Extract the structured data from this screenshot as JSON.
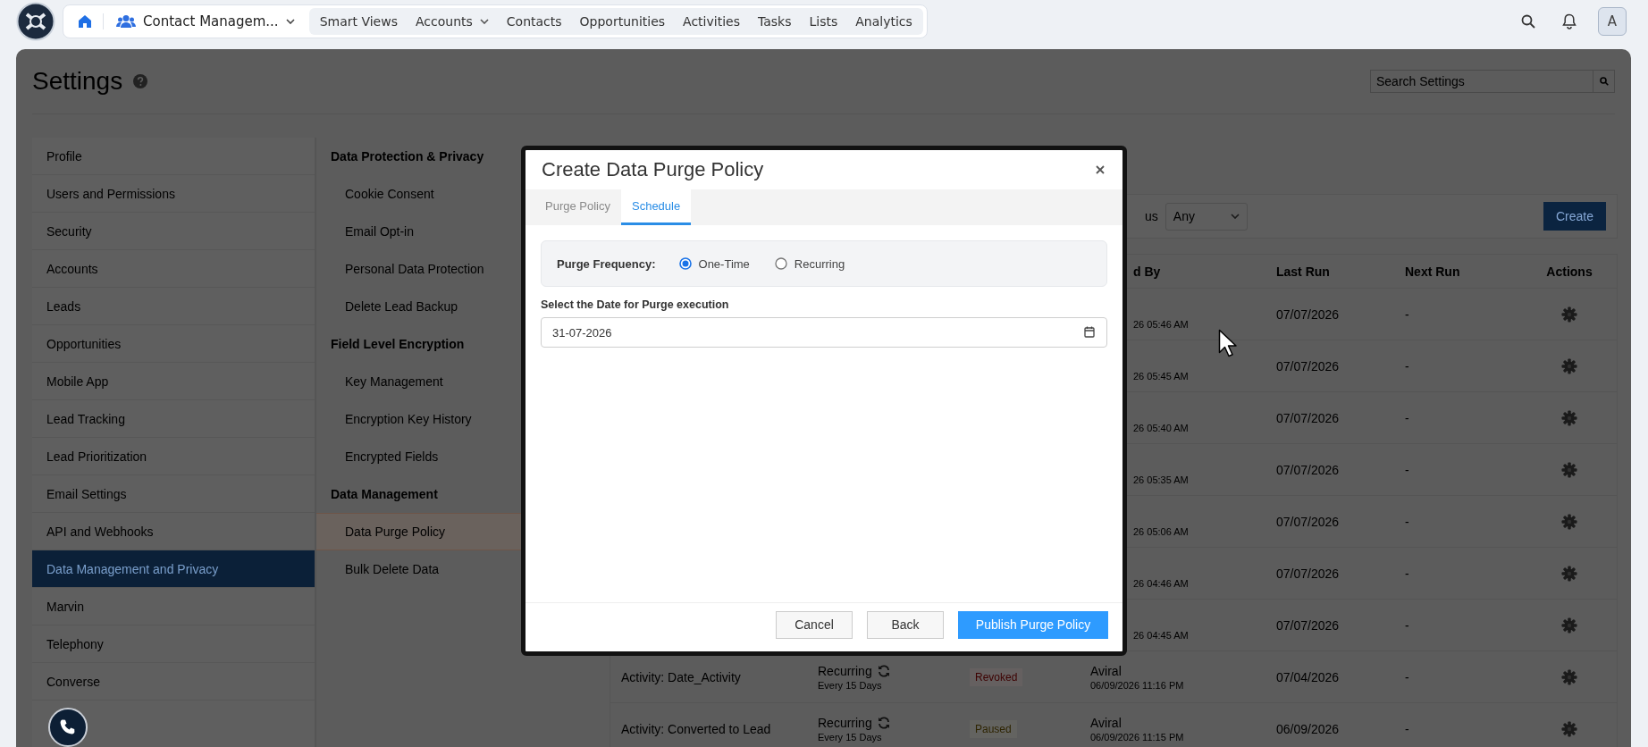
{
  "nav": {
    "app_name": "Contact Managem...",
    "menu": [
      {
        "label": "Smart Views",
        "dropdown": false
      },
      {
        "label": "Accounts",
        "dropdown": true
      },
      {
        "label": "Contacts",
        "dropdown": false
      },
      {
        "label": "Opportunities",
        "dropdown": false
      },
      {
        "label": "Activities",
        "dropdown": false
      },
      {
        "label": "Tasks",
        "dropdown": false
      },
      {
        "label": "Lists",
        "dropdown": false
      },
      {
        "label": "Analytics",
        "dropdown": false
      }
    ],
    "avatar": "A"
  },
  "settings": {
    "title": "Settings",
    "search": {
      "placeholder": "Search Settings"
    },
    "categories": [
      {
        "label": "Profile",
        "selected": false
      },
      {
        "label": "Users and Permissions",
        "selected": false
      },
      {
        "label": "Security",
        "selected": false
      },
      {
        "label": "Accounts",
        "selected": false
      },
      {
        "label": "Leads",
        "selected": false
      },
      {
        "label": "Opportunities",
        "selected": false
      },
      {
        "label": "Mobile App",
        "selected": false
      },
      {
        "label": "Lead Tracking",
        "selected": false
      },
      {
        "label": "Lead Prioritization",
        "selected": false
      },
      {
        "label": "Email Settings",
        "selected": false
      },
      {
        "label": "API and Webhooks",
        "selected": false
      },
      {
        "label": "Data Management and Privacy",
        "selected": true
      },
      {
        "label": "Marvin",
        "selected": false
      },
      {
        "label": "Telephony",
        "selected": false
      },
      {
        "label": "Converse",
        "selected": false
      }
    ],
    "subnav": [
      {
        "heading": "Data Protection & Privacy",
        "items": [
          {
            "label": "Cookie Consent",
            "selected": false
          },
          {
            "label": "Email Opt-in",
            "selected": false
          },
          {
            "label": "Personal Data Protection",
            "selected": false
          },
          {
            "label": "Delete Lead Backup",
            "selected": false
          }
        ]
      },
      {
        "heading": "Field Level Encryption",
        "items": [
          {
            "label": "Key Management",
            "selected": false
          },
          {
            "label": "Encryption Key History",
            "selected": false
          },
          {
            "label": "Encrypted Fields",
            "selected": false
          }
        ]
      },
      {
        "heading": "Data Management",
        "items": [
          {
            "label": "Data Purge Policy",
            "selected": true
          },
          {
            "label": "Bulk Delete Data",
            "selected": false
          }
        ]
      }
    ]
  },
  "policies": {
    "filter": {
      "label": "us",
      "value": "Any"
    },
    "create_button": "Create",
    "columns": [
      "d By",
      "Last Run",
      "Next Run",
      "Actions"
    ],
    "rows": [
      {
        "kind": "partial",
        "created_at": "26 05:46 AM",
        "last_run": "07/07/2026",
        "next_run": "-"
      },
      {
        "kind": "partial",
        "created_at": "26 05:45 AM",
        "last_run": "07/07/2026",
        "next_run": "-"
      },
      {
        "kind": "partial",
        "created_at": "26 05:40 AM",
        "last_run": "07/07/2026",
        "next_run": "-"
      },
      {
        "kind": "partial",
        "created_at": "26 05:35 AM",
        "last_run": "07/07/2026",
        "next_run": "-"
      },
      {
        "kind": "partial",
        "created_at": "26 05:06 AM",
        "last_run": "07/07/2026",
        "next_run": "-"
      },
      {
        "kind": "partial",
        "created_at": "26 04:46 AM",
        "last_run": "07/07/2026",
        "next_run": "-"
      },
      {
        "kind": "partial",
        "created_at": "26 04:45 AM",
        "last_run": "07/07/2026",
        "next_run": "-"
      },
      {
        "kind": "full",
        "name": "Activity: Date_Activity",
        "schedule": "Recurring",
        "interval": "Every 15 Days",
        "status": {
          "label": "Revoked",
          "color": "#3d0000"
        },
        "created_by": "Aviral",
        "created_at": "06/09/2026 11:16 PM",
        "last_run": "07/04/2026",
        "next_run": "-"
      },
      {
        "kind": "full",
        "name": "Activity: Converted to Lead",
        "schedule": "Recurring",
        "interval": "Every 15 Days",
        "status": {
          "label": "Paused",
          "color": "#2e2400"
        },
        "created_by": "Aviral",
        "created_at": "06/09/2026 11:15 PM",
        "last_run": "06/09/2026",
        "next_run": "-"
      }
    ]
  },
  "dialog": {
    "title": "Create Data Purge Policy",
    "tabs": [
      {
        "label": "Purge Policy",
        "selected": false
      },
      {
        "label": "Schedule",
        "selected": true
      }
    ],
    "frequency": {
      "label": "Purge Frequency:",
      "options": [
        {
          "label": "One-Time",
          "selected": true
        },
        {
          "label": "Recurring",
          "selected": false
        }
      ]
    },
    "date": {
      "label": "Select the Date for Purge execution",
      "value": "31-07-2026"
    },
    "buttons": [
      {
        "label": "Cancel",
        "kind": "secondary"
      },
      {
        "label": "Back",
        "kind": "secondary"
      },
      {
        "label": "Publish Purge Policy",
        "kind": "primary"
      }
    ]
  }
}
